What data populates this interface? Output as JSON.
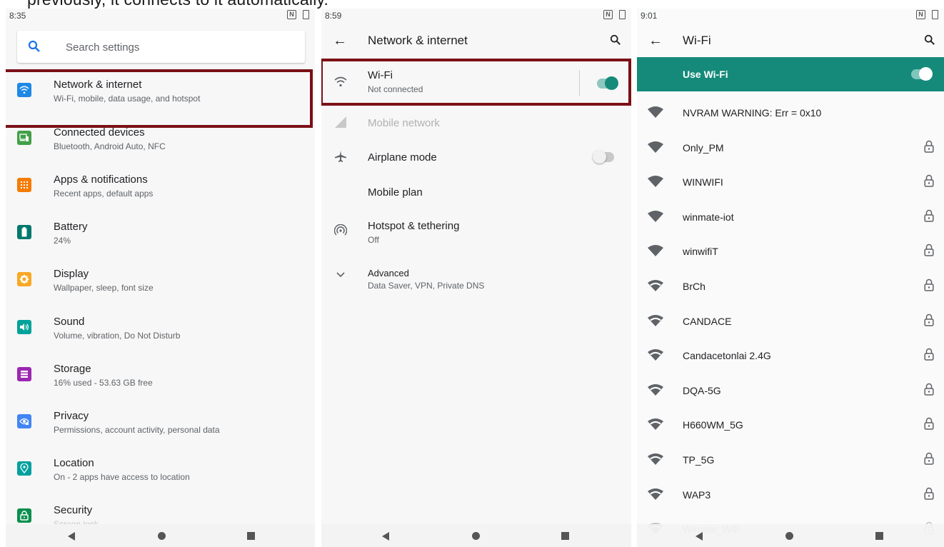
{
  "caption": "previously, it connects to it automatically.",
  "panel1": {
    "status_time": "8:35",
    "search_placeholder": "Search settings",
    "items": [
      {
        "title": "Network & internet",
        "subtitle": "Wi-Fi, mobile, data usage, and hotspot",
        "icon": "wifi-icon",
        "color": "#1e88e5"
      },
      {
        "title": "Connected devices",
        "subtitle": "Bluetooth, Android Auto, NFC",
        "icon": "devices-icon",
        "color": "#43a047"
      },
      {
        "title": "Apps & notifications",
        "subtitle": "Recent apps, default apps",
        "icon": "apps-icon",
        "color": "#f57c00"
      },
      {
        "title": "Battery",
        "subtitle": "24%",
        "icon": "battery-icon",
        "color": "#00796b"
      },
      {
        "title": "Display",
        "subtitle": "Wallpaper, sleep, font size",
        "icon": "display-icon",
        "color": "#f9a825"
      },
      {
        "title": "Sound",
        "subtitle": "Volume, vibration, Do Not Disturb",
        "icon": "sound-icon",
        "color": "#00a29a"
      },
      {
        "title": "Storage",
        "subtitle": "16% used - 53.63 GB free",
        "icon": "storage-icon",
        "color": "#9c27b0"
      },
      {
        "title": "Privacy",
        "subtitle": "Permissions, account activity, personal data",
        "icon": "privacy-icon",
        "color": "#4285f4"
      },
      {
        "title": "Location",
        "subtitle": "On - 2 apps have access to location",
        "icon": "location-icon",
        "color": "#00a0a0"
      },
      {
        "title": "Security",
        "subtitle": "Screen lock",
        "icon": "lock-icon",
        "color": "#0a8f4e"
      }
    ]
  },
  "panel2": {
    "status_time": "8:59",
    "title": "Network & internet",
    "wifi": {
      "title": "Wi-Fi",
      "subtitle": "Not connected",
      "enabled": true
    },
    "mobile_network": "Mobile network",
    "airplane": {
      "title": "Airplane mode",
      "enabled": false
    },
    "mobile_plan": "Mobile plan",
    "hotspot": {
      "title": "Hotspot & tethering",
      "subtitle": "Off"
    },
    "advanced": {
      "title": "Advanced",
      "subtitle": "Data Saver, VPN, Private DNS"
    },
    "accent": "#158a7a"
  },
  "panel3": {
    "status_time": "9:01",
    "title": "Wi-Fi",
    "use_wifi": "Use Wi-Fi",
    "use_wifi_enabled": true,
    "bar_color": "#158a7a",
    "networks": [
      {
        "name": "NVRAM WARNING: Err = 0x10",
        "locked": false,
        "strength": "full"
      },
      {
        "name": "Only_PM",
        "locked": true,
        "strength": "full"
      },
      {
        "name": "WINWIFI",
        "locked": true,
        "strength": "full"
      },
      {
        "name": "winmate-iot",
        "locked": true,
        "strength": "full"
      },
      {
        "name": "winwifiT",
        "locked": true,
        "strength": "full"
      },
      {
        "name": "BrCh",
        "locked": true,
        "strength": "partial"
      },
      {
        "name": "CANDACE",
        "locked": true,
        "strength": "partial"
      },
      {
        "name": "Candacetonlai 2.4G",
        "locked": true,
        "strength": "partial"
      },
      {
        "name": "DQA-5G",
        "locked": true,
        "strength": "partial"
      },
      {
        "name": "H660WM_5G",
        "locked": true,
        "strength": "partial"
      },
      {
        "name": "TP_5G",
        "locked": true,
        "strength": "partial"
      },
      {
        "name": "WAP3",
        "locked": true,
        "strength": "partial"
      },
      {
        "name": "Wimate_Wifi",
        "locked": true,
        "strength": "partial"
      }
    ]
  }
}
